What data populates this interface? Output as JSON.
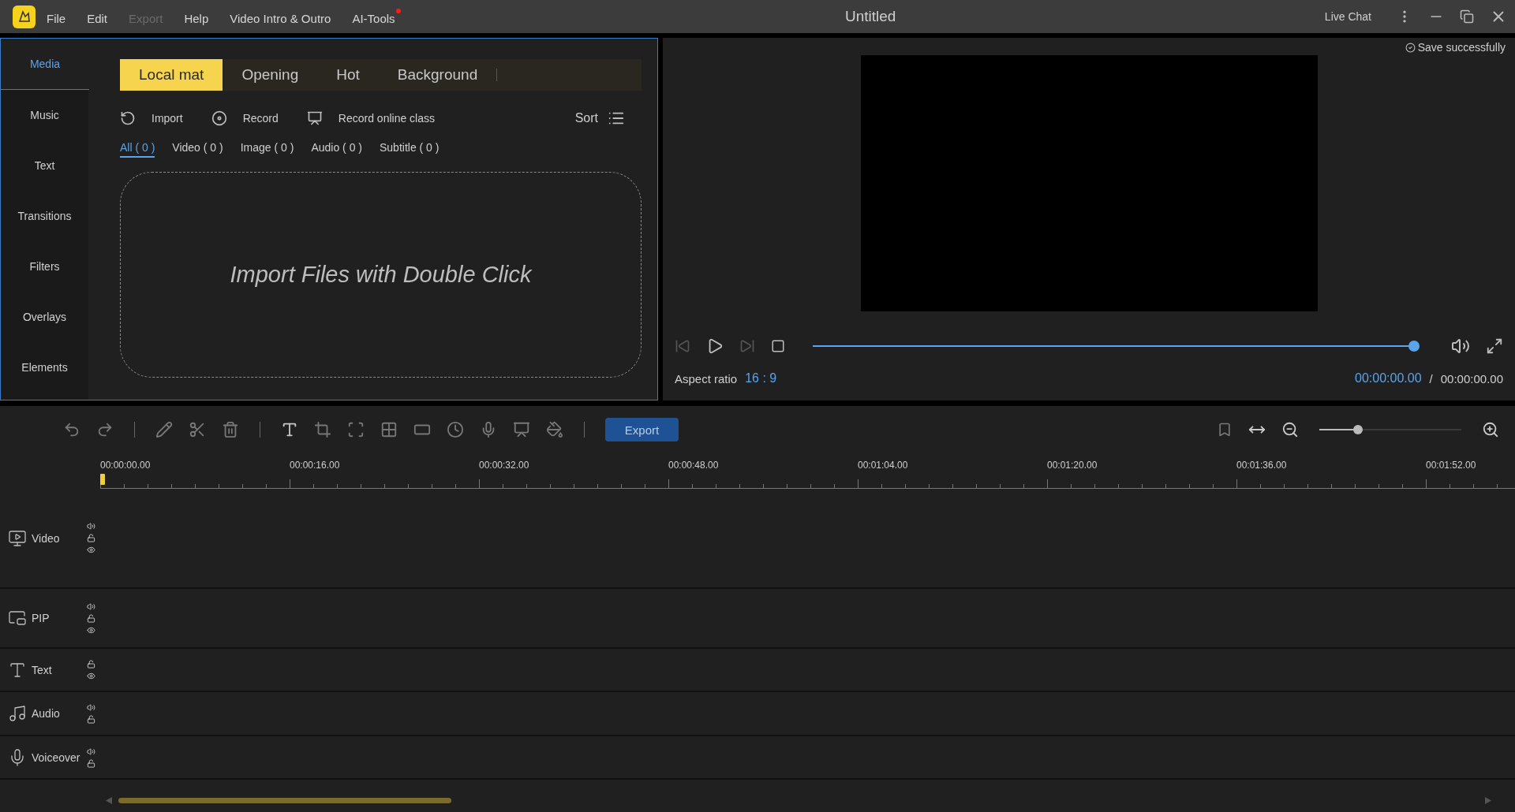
{
  "app_bar": {
    "menu": [
      {
        "label": "File",
        "disabled": false,
        "dot": false
      },
      {
        "label": "Edit",
        "disabled": false,
        "dot": false
      },
      {
        "label": "Export",
        "disabled": true,
        "dot": false
      },
      {
        "label": "Help",
        "disabled": false,
        "dot": false
      },
      {
        "label": "Video Intro & Outro",
        "disabled": false,
        "dot": false
      },
      {
        "label": "AI-Tools",
        "disabled": false,
        "dot": true
      }
    ],
    "title": "Untitled",
    "live_chat": "Live Chat"
  },
  "save_status": "Save successfully",
  "sidebar": {
    "items": [
      {
        "label": "Media",
        "selected": true
      },
      {
        "label": "Music",
        "selected": false
      },
      {
        "label": "Text",
        "selected": false
      },
      {
        "label": "Transitions",
        "selected": false
      },
      {
        "label": "Filters",
        "selected": false
      },
      {
        "label": "Overlays",
        "selected": false
      },
      {
        "label": "Elements",
        "selected": false
      }
    ]
  },
  "media_tabs": [
    {
      "label": "Local mat",
      "selected": true
    },
    {
      "label": "Opening",
      "selected": false
    },
    {
      "label": "Hot",
      "selected": false
    },
    {
      "label": "Background",
      "selected": false
    }
  ],
  "actions": [
    {
      "kind": "import",
      "label": "Import"
    },
    {
      "kind": "record",
      "label": "Record"
    },
    {
      "kind": "screen",
      "label": "Record online class"
    }
  ],
  "sort": "Sort",
  "filters": [
    {
      "label": "All ( 0 )",
      "selected": true
    },
    {
      "label": "Video ( 0 )",
      "selected": false
    },
    {
      "label": "Image ( 0 )",
      "selected": false
    },
    {
      "label": "Audio ( 0 )",
      "selected": false
    },
    {
      "label": "Subtitle ( 0 )",
      "selected": false
    }
  ],
  "drop_zone": "Import Files with Double Click",
  "player": {
    "progress": {
      "level": 1
    },
    "aspect_label": "Aspect ratio",
    "aspect_value": "16 : 9",
    "current_time": "00:00:00.00",
    "separator": "/",
    "total_time": "00:00:00.00"
  },
  "toolbar": {
    "tools": [
      {
        "kind": "undo"
      },
      {
        "kind": "redo"
      },
      {
        "kind": "divider"
      },
      {
        "kind": "edit"
      },
      {
        "kind": "cut"
      },
      {
        "kind": "delete"
      },
      {
        "kind": "divider"
      },
      {
        "kind": "text"
      },
      {
        "kind": "crop"
      },
      {
        "kind": "frame"
      },
      {
        "kind": "mosaic"
      },
      {
        "kind": "freeze"
      },
      {
        "kind": "speed"
      },
      {
        "kind": "voice"
      },
      {
        "kind": "presenter"
      },
      {
        "kind": "color"
      },
      {
        "kind": "divider"
      }
    ],
    "export": "Export",
    "zoom": {
      "level": 0.27
    }
  },
  "ruler": {
    "labels": [
      "00:00:00.00",
      "00:00:16.00",
      "00:00:32.00",
      "00:00:48.00",
      "00:01:04.00",
      "00:01:20.00",
      "00:01:36.00",
      "00:01:52.00"
    ]
  },
  "tracks": [
    {
      "label": "Video",
      "kind": "video",
      "sound": true,
      "lock": true,
      "eye": true
    },
    {
      "label": "PIP",
      "kind": "pip",
      "sound": true,
      "lock": true,
      "eye": true
    },
    {
      "label": "Text",
      "kind": "text",
      "lock": true,
      "eye": true
    },
    {
      "label": "Audio",
      "kind": "audio",
      "sound": true,
      "lock": true
    },
    {
      "label": "Voiceover",
      "kind": "voiceover",
      "sound": true,
      "lock": true
    }
  ]
}
